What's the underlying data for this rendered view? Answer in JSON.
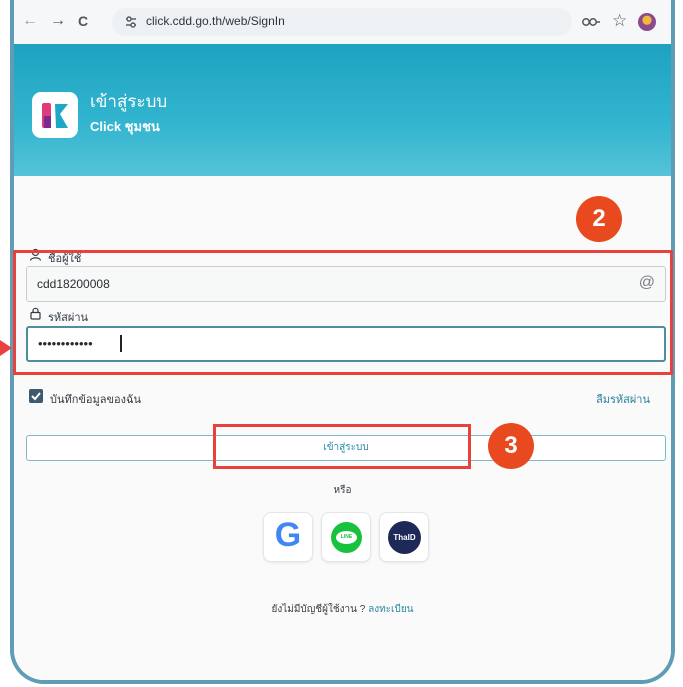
{
  "browser": {
    "url": "click.cdd.go.th/web/SignIn",
    "back_icon": "back-arrow-icon",
    "forward_icon": "forward-arrow-icon",
    "reload_label": "C"
  },
  "header": {
    "title": "เข้าสู่ระบบ",
    "subtitle": "Click ชุมชน"
  },
  "form": {
    "username_label": "ชื่อผู้ใช้",
    "username_value": "cdd18200008",
    "username_suffix": "@",
    "password_label": "รหัสผ่าน",
    "password_value": "••••••••••••",
    "remember_label": "บันทึกข้อมูลของฉัน",
    "forgot_label": "ลืมรหัสผ่าน",
    "login_button": "เข้าสู่ระบบ",
    "or_label": "หรือ",
    "no_account": "ยังไม่มีบัญชีผู้ใช้งาน ?",
    "register_link": "ลงทะเบียน"
  },
  "social": {
    "google_label": "G",
    "line_label": "LINE",
    "thaiid_label": "ThaID"
  },
  "annotations": {
    "step2": "2",
    "step3": "3"
  },
  "colors": {
    "accent": "#29a9c6",
    "highlight": "#e8413e",
    "badge": "#e8491e"
  }
}
